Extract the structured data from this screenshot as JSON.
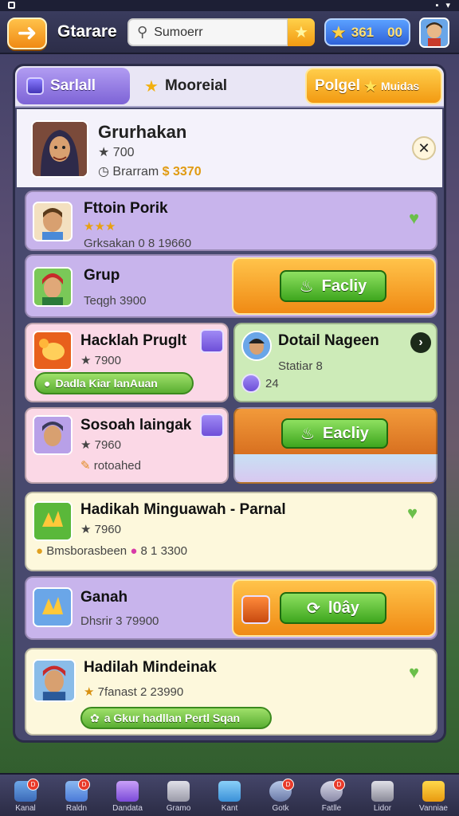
{
  "header": {
    "back_icon": "back-arrow-icon",
    "title": "Gtarare",
    "search_placeholder": "Sumoerr",
    "currency_value": "361",
    "currency_value2": "00"
  },
  "tabs": [
    {
      "label": "Sarlall"
    },
    {
      "label": "Mooreial"
    },
    {
      "label": "Polgel",
      "extra": "Muidas"
    }
  ],
  "profile": {
    "name": "Grurhakan",
    "level": "★ 700",
    "meta_prefix": "Brarram",
    "meta_value": "$ 3370"
  },
  "cards": [
    {
      "title": "Fttoin Porik",
      "stars": "★★★",
      "meta": "Grksakan 0 8 19660"
    },
    {
      "title": "Grup",
      "meta": "Teqgh 3900",
      "action": "Facliy"
    },
    {
      "title": "Hacklah Pruglt",
      "meta": "★ 7900",
      "pill": "Dadla Kiar lanAuan"
    },
    {
      "title": "Dotail Nageen",
      "meta": "Statiar 8",
      "sub": "24"
    },
    {
      "title": "Sosoah laingak",
      "meta": "★ 7960",
      "sub": "rotoahed"
    },
    {
      "title": "Eacliy"
    },
    {
      "title": "Hadikah Minguawah - Parnal",
      "meta": "★ 7960",
      "sub": "Bmsborasbeen",
      "sub_value": "8 1 3300"
    },
    {
      "title": "Ganah",
      "meta": "Dhsrir 3 79900",
      "action": "l0ây"
    },
    {
      "title": "Hadilah Mindeinak",
      "meta": "7fanast 2 23990",
      "pill": "a Gkur hadllan Pertl Sqan"
    }
  ],
  "nav": [
    {
      "label": "Kanal",
      "badge": "D"
    },
    {
      "label": "Raldn",
      "badge": "D"
    },
    {
      "label": "Dandata"
    },
    {
      "label": "Gramo"
    },
    {
      "label": "Kant"
    },
    {
      "label": "Gotk",
      "badge": "D"
    },
    {
      "label": "Fatlle",
      "badge": "D"
    },
    {
      "label": "Lidor"
    },
    {
      "label": "Vanniae"
    }
  ]
}
